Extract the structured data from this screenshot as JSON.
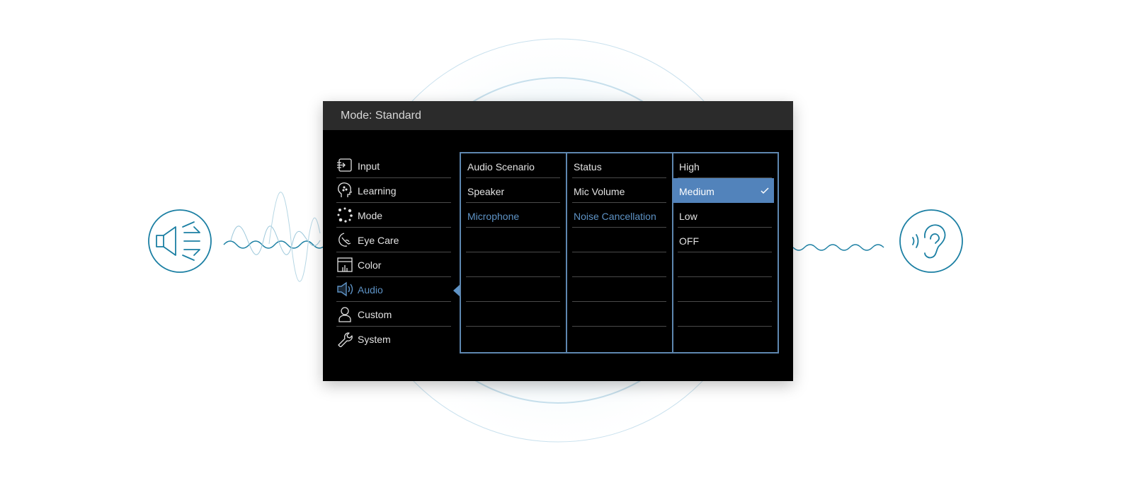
{
  "osd": {
    "header_title": "Mode: Standard",
    "menu": [
      {
        "label": "Input",
        "icon": "input-icon"
      },
      {
        "label": "Learning",
        "icon": "learning-head-icon"
      },
      {
        "label": "Mode",
        "icon": "mode-dots-icon"
      },
      {
        "label": "Eye Care",
        "icon": "eye-care-icon"
      },
      {
        "label": "Color",
        "icon": "color-icon"
      },
      {
        "label": "Audio",
        "icon": "speaker-icon",
        "active": true
      },
      {
        "label": "Custom",
        "icon": "person-icon"
      },
      {
        "label": "System",
        "icon": "wrench-icon"
      }
    ],
    "columns": {
      "audio": [
        "Audio Scenario",
        "Speaker",
        "Microphone"
      ],
      "microphone": [
        "Status",
        "Mic Volume",
        "Noise Cancellation"
      ],
      "noise_cancellation": [
        "High",
        "Medium",
        "Low",
        "OFF"
      ]
    },
    "selected_value": "Medium"
  },
  "decor": {
    "left_icon": "speaker-sound-icon",
    "right_icon": "ear-sound-icon"
  },
  "colors": {
    "accent": "#5e93c6",
    "selection": "#5283bb",
    "panel_border": "#5e87b0",
    "decor_teal": "#1b7fa3"
  }
}
